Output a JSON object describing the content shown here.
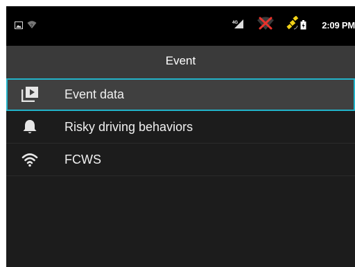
{
  "statusbar": {
    "time": "2:09 PM",
    "icons": [
      "image-notification-icon",
      "wifi-question-icon",
      "signal-4g-icon",
      "no-signal-icon",
      "gps-satellite-icon",
      "battery-icon"
    ]
  },
  "header": {
    "title": "Event"
  },
  "menu": {
    "items": [
      {
        "label": "Event data",
        "icon": "video-library-icon",
        "selected": true
      },
      {
        "label": "Risky driving behaviors",
        "icon": "bell-icon",
        "selected": false
      },
      {
        "label": "FCWS",
        "icon": "wifi-icon",
        "selected": false
      }
    ]
  },
  "colors": {
    "selection_border": "#22b3c9",
    "background": "#1c1c1c",
    "titlebar": "#3a3a3a"
  }
}
